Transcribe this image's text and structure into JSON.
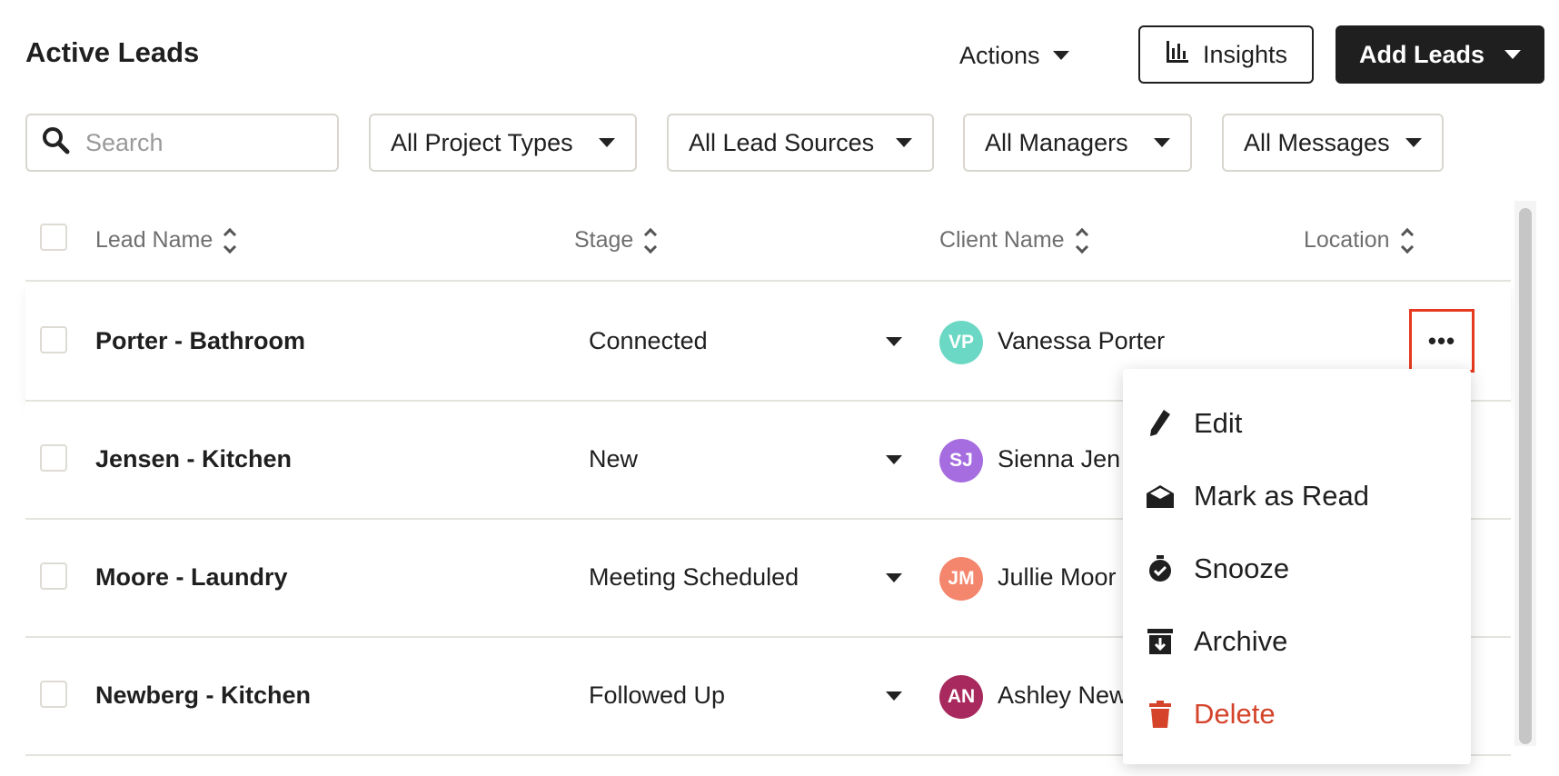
{
  "header": {
    "title": "Active Leads",
    "actions_label": "Actions",
    "insights_label": "Insights",
    "add_leads_label": "Add Leads"
  },
  "filters": {
    "search_placeholder": "Search",
    "project_types": "All Project Types",
    "lead_sources": "All Lead Sources",
    "managers": "All Managers",
    "messages": "All Messages"
  },
  "table": {
    "columns": [
      "Lead Name",
      "Stage",
      "Client Name",
      "Location"
    ],
    "rows": [
      {
        "lead": "Porter - Bathroom",
        "stage": "Connected",
        "initials": "VP",
        "avatar_color": "#6ad8c4",
        "client": "Vanessa Porter"
      },
      {
        "lead": "Jensen - Kitchen",
        "stage": "New",
        "initials": "SJ",
        "avatar_color": "#a66de0",
        "client": "Sienna Jen"
      },
      {
        "lead": "Moore - Laundry",
        "stage": "Meeting Scheduled",
        "initials": "JM",
        "avatar_color": "#f4866e",
        "client": "Jullie Moor"
      },
      {
        "lead": "Newberg - Kitchen",
        "stage": "Followed Up",
        "initials": "AN",
        "avatar_color": "#a8295d",
        "client": "Ashley New"
      }
    ]
  },
  "row_menu": {
    "more_label": "•••",
    "items": [
      {
        "label": "Edit",
        "icon": "pencil-icon"
      },
      {
        "label": "Mark as Read",
        "icon": "envelope-open-icon"
      },
      {
        "label": "Snooze",
        "icon": "alarm-clock-icon"
      },
      {
        "label": "Archive",
        "icon": "archive-box-icon"
      },
      {
        "label": "Delete",
        "icon": "trash-icon"
      }
    ]
  },
  "colors": {
    "primary_dark": "#1f1f1f",
    "danger": "#d4432a",
    "highlight_border": "#e53a1e"
  }
}
